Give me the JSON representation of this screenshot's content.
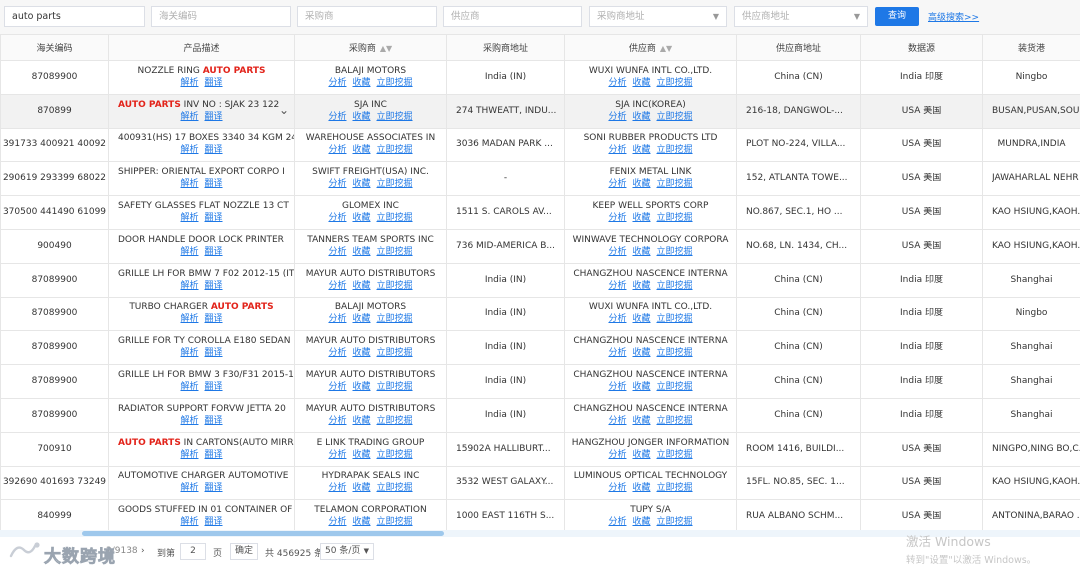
{
  "search": {
    "keyword": "auto parts",
    "hs_code_placeholder": "海关编码",
    "buyer_placeholder": "采购商",
    "supplier_placeholder": "供应商",
    "buyer_addr_placeholder": "采购商地址",
    "supplier_addr_placeholder": "供应商地址",
    "query_label": "查询",
    "advanced_label": "高级搜索>>"
  },
  "table": {
    "headers": [
      "海关编码",
      "产品描述",
      "采购商",
      "采购商地址",
      "供应商",
      "供应商地址",
      "数据源",
      "装货港"
    ],
    "row_action_labels": [
      "解析",
      "翻译"
    ],
    "party_action_labels": [
      "分析",
      "收藏",
      "立即挖掘"
    ],
    "rows": [
      {
        "hs": "87089900",
        "desc_pre": "NOZZLE RING ",
        "desc_hi": "AUTO PARTS",
        "desc_post": "",
        "buyer": "BALAJI MOTORS",
        "buyer_addr": "India (IN)",
        "supplier": "WUXI WUNFA INTL CO.,LTD.",
        "supplier_addr": "China (CN)",
        "source": "India 印度",
        "port": "Ningbo"
      },
      {
        "hs": "870899",
        "desc_pre": "",
        "desc_hi": "AUTO PARTS",
        "desc_post": " INV NO : SJAK 23 122",
        "buyer": "SJA INC",
        "buyer_addr": "274 THWEATT, INDU...",
        "supplier": "SJA INC(KOREA)",
        "supplier_addr": "216-18, DANGWOL-...",
        "source": "USA 美国",
        "port": "BUSAN,PUSAN,SOU"
      },
      {
        "hs": "391733 400921 40092",
        "desc_pre": "400931(HS) 17 BOXES 3340 34 KGM 24",
        "desc_hi": "",
        "desc_post": "",
        "buyer": "WAREHOUSE ASSOCIATES IN",
        "buyer_addr": "3036 MADAN PARK ...",
        "supplier": "SONI RUBBER PRODUCTS LTD",
        "supplier_addr": "PLOT NO-224, VILLA...",
        "source": "USA 美国",
        "port": "MUNDRA,INDIA"
      },
      {
        "hs": "290619 293399 68022",
        "desc_pre": "SHIPPER: ORIENTAL EXPORT CORPO I",
        "desc_hi": "",
        "desc_post": "",
        "buyer": "SWIFT FREIGHT(USA) INC.",
        "buyer_addr": "-",
        "supplier": "FENIX METAL LINK",
        "supplier_addr": "152, ATLANTA TOWE...",
        "source": "USA 美国",
        "port": "JAWAHARLAL NEHR"
      },
      {
        "hs": "370500 441490 61099",
        "desc_pre": "SAFETY GLASSES FLAT NOZZLE 13 CT",
        "desc_hi": "",
        "desc_post": "",
        "buyer": "GLOMEX INC",
        "buyer_addr": "1511 S. CAROLS AV...",
        "supplier": "KEEP WELL SPORTS CORP",
        "supplier_addr": "NO.867, SEC.1, HO ...",
        "source": "USA 美国",
        "port": "KAO HSIUNG,KAOH..."
      },
      {
        "hs": "900490",
        "desc_pre": "DOOR HANDLE DOOR LOCK PRINTER",
        "desc_hi": "",
        "desc_post": "",
        "buyer": "TANNERS TEAM SPORTS INC",
        "buyer_addr": "736 MID-AMERICA B...",
        "supplier": "WINWAVE TECHNOLOGY CORPORA",
        "supplier_addr": "NO.68, LN. 1434, CH...",
        "source": "USA 美国",
        "port": "KAO HSIUNG,KAOH..."
      },
      {
        "hs": "87089900",
        "desc_pre": "GRILLE LH FOR BMW 7 F02 2012-15 (IT",
        "desc_hi": "",
        "desc_post": "",
        "buyer": "MAYUR AUTO DISTRIBUTORS",
        "buyer_addr": "India (IN)",
        "supplier": "CHANGZHOU NASCENCE INTERNA",
        "supplier_addr": "China (CN)",
        "source": "India 印度",
        "port": "Shanghai"
      },
      {
        "hs": "87089900",
        "desc_pre": "TURBO CHARGER ",
        "desc_hi": "AUTO PARTS",
        "desc_post": "",
        "buyer": "BALAJI MOTORS",
        "buyer_addr": "India (IN)",
        "supplier": "WUXI WUNFA INTL CO.,LTD.",
        "supplier_addr": "China (CN)",
        "source": "India 印度",
        "port": "Ningbo"
      },
      {
        "hs": "87089900",
        "desc_pre": "GRILLE FOR TY COROLLA E180 SEDAN",
        "desc_hi": "",
        "desc_post": "",
        "buyer": "MAYUR AUTO DISTRIBUTORS",
        "buyer_addr": "India (IN)",
        "supplier": "CHANGZHOU NASCENCE INTERNA",
        "supplier_addr": "China (CN)",
        "source": "India 印度",
        "port": "Shanghai"
      },
      {
        "hs": "87089900",
        "desc_pre": "GRILLE LH FOR BMW 3 F30/F31 2015-18",
        "desc_hi": "",
        "desc_post": "",
        "buyer": "MAYUR AUTO DISTRIBUTORS",
        "buyer_addr": "India (IN)",
        "supplier": "CHANGZHOU NASCENCE INTERNA",
        "supplier_addr": "China (CN)",
        "source": "India 印度",
        "port": "Shanghai"
      },
      {
        "hs": "87089900",
        "desc_pre": "RADIATOR SUPPORT FORVW JETTA 20",
        "desc_hi": "",
        "desc_post": "",
        "buyer": "MAYUR AUTO DISTRIBUTORS",
        "buyer_addr": "India (IN)",
        "supplier": "CHANGZHOU NASCENCE INTERNA",
        "supplier_addr": "China (CN)",
        "source": "India 印度",
        "port": "Shanghai"
      },
      {
        "hs": "700910",
        "desc_pre": "",
        "desc_hi": "AUTO PARTS",
        "desc_post": " IN CARTONS(AUTO MIRR",
        "buyer": "E LINK TRADING GROUP",
        "buyer_addr": "15902A HALLIBURT...",
        "supplier": "HANGZHOU JONGER INFORMATION",
        "supplier_addr": "ROOM 1416, BUILDI...",
        "source": "USA 美国",
        "port": "NINGPO,NING BO,C..."
      },
      {
        "hs": "392690 401693 73249",
        "desc_pre": "AUTOMOTIVE CHARGER AUTOMOTIVE",
        "desc_hi": "",
        "desc_post": "",
        "buyer": "HYDRAPAK SEALS INC",
        "buyer_addr": "3532 WEST GALAXY...",
        "supplier": "LUMINOUS OPTICAL TECHNOLOGY",
        "supplier_addr": "15FL. NO.85, SEC. 1...",
        "source": "USA 美国",
        "port": "KAO HSIUNG,KAOH..."
      },
      {
        "hs": "840999",
        "desc_pre": "GOODS STUFFED IN 01 CONTAINER OF",
        "desc_hi": "",
        "desc_post": "",
        "buyer": "TELAMON CORPORATION",
        "buyer_addr": "1000 EAST 116TH S...",
        "supplier": "TUPY S/A",
        "supplier_addr": "RUA ALBANO SCHM...",
        "source": "USA 美国",
        "port": "ANTONINA,BARAO ..."
      }
    ]
  },
  "pager": {
    "goto_label": "到第",
    "page_value": "2",
    "page_unit": "页",
    "confirm_label": "确定",
    "total_text": "共 456925 条",
    "page_size": "50 条/页",
    "partial_text": "2/9138"
  },
  "brand": {
    "logo_text": "大数跨境"
  },
  "watermark": {
    "line1": "激活 Windows",
    "line2": "转到\"设置\"以激活 Windows。"
  },
  "colors": {
    "accent": "#1e78e6",
    "highlight": "#e2231a"
  }
}
